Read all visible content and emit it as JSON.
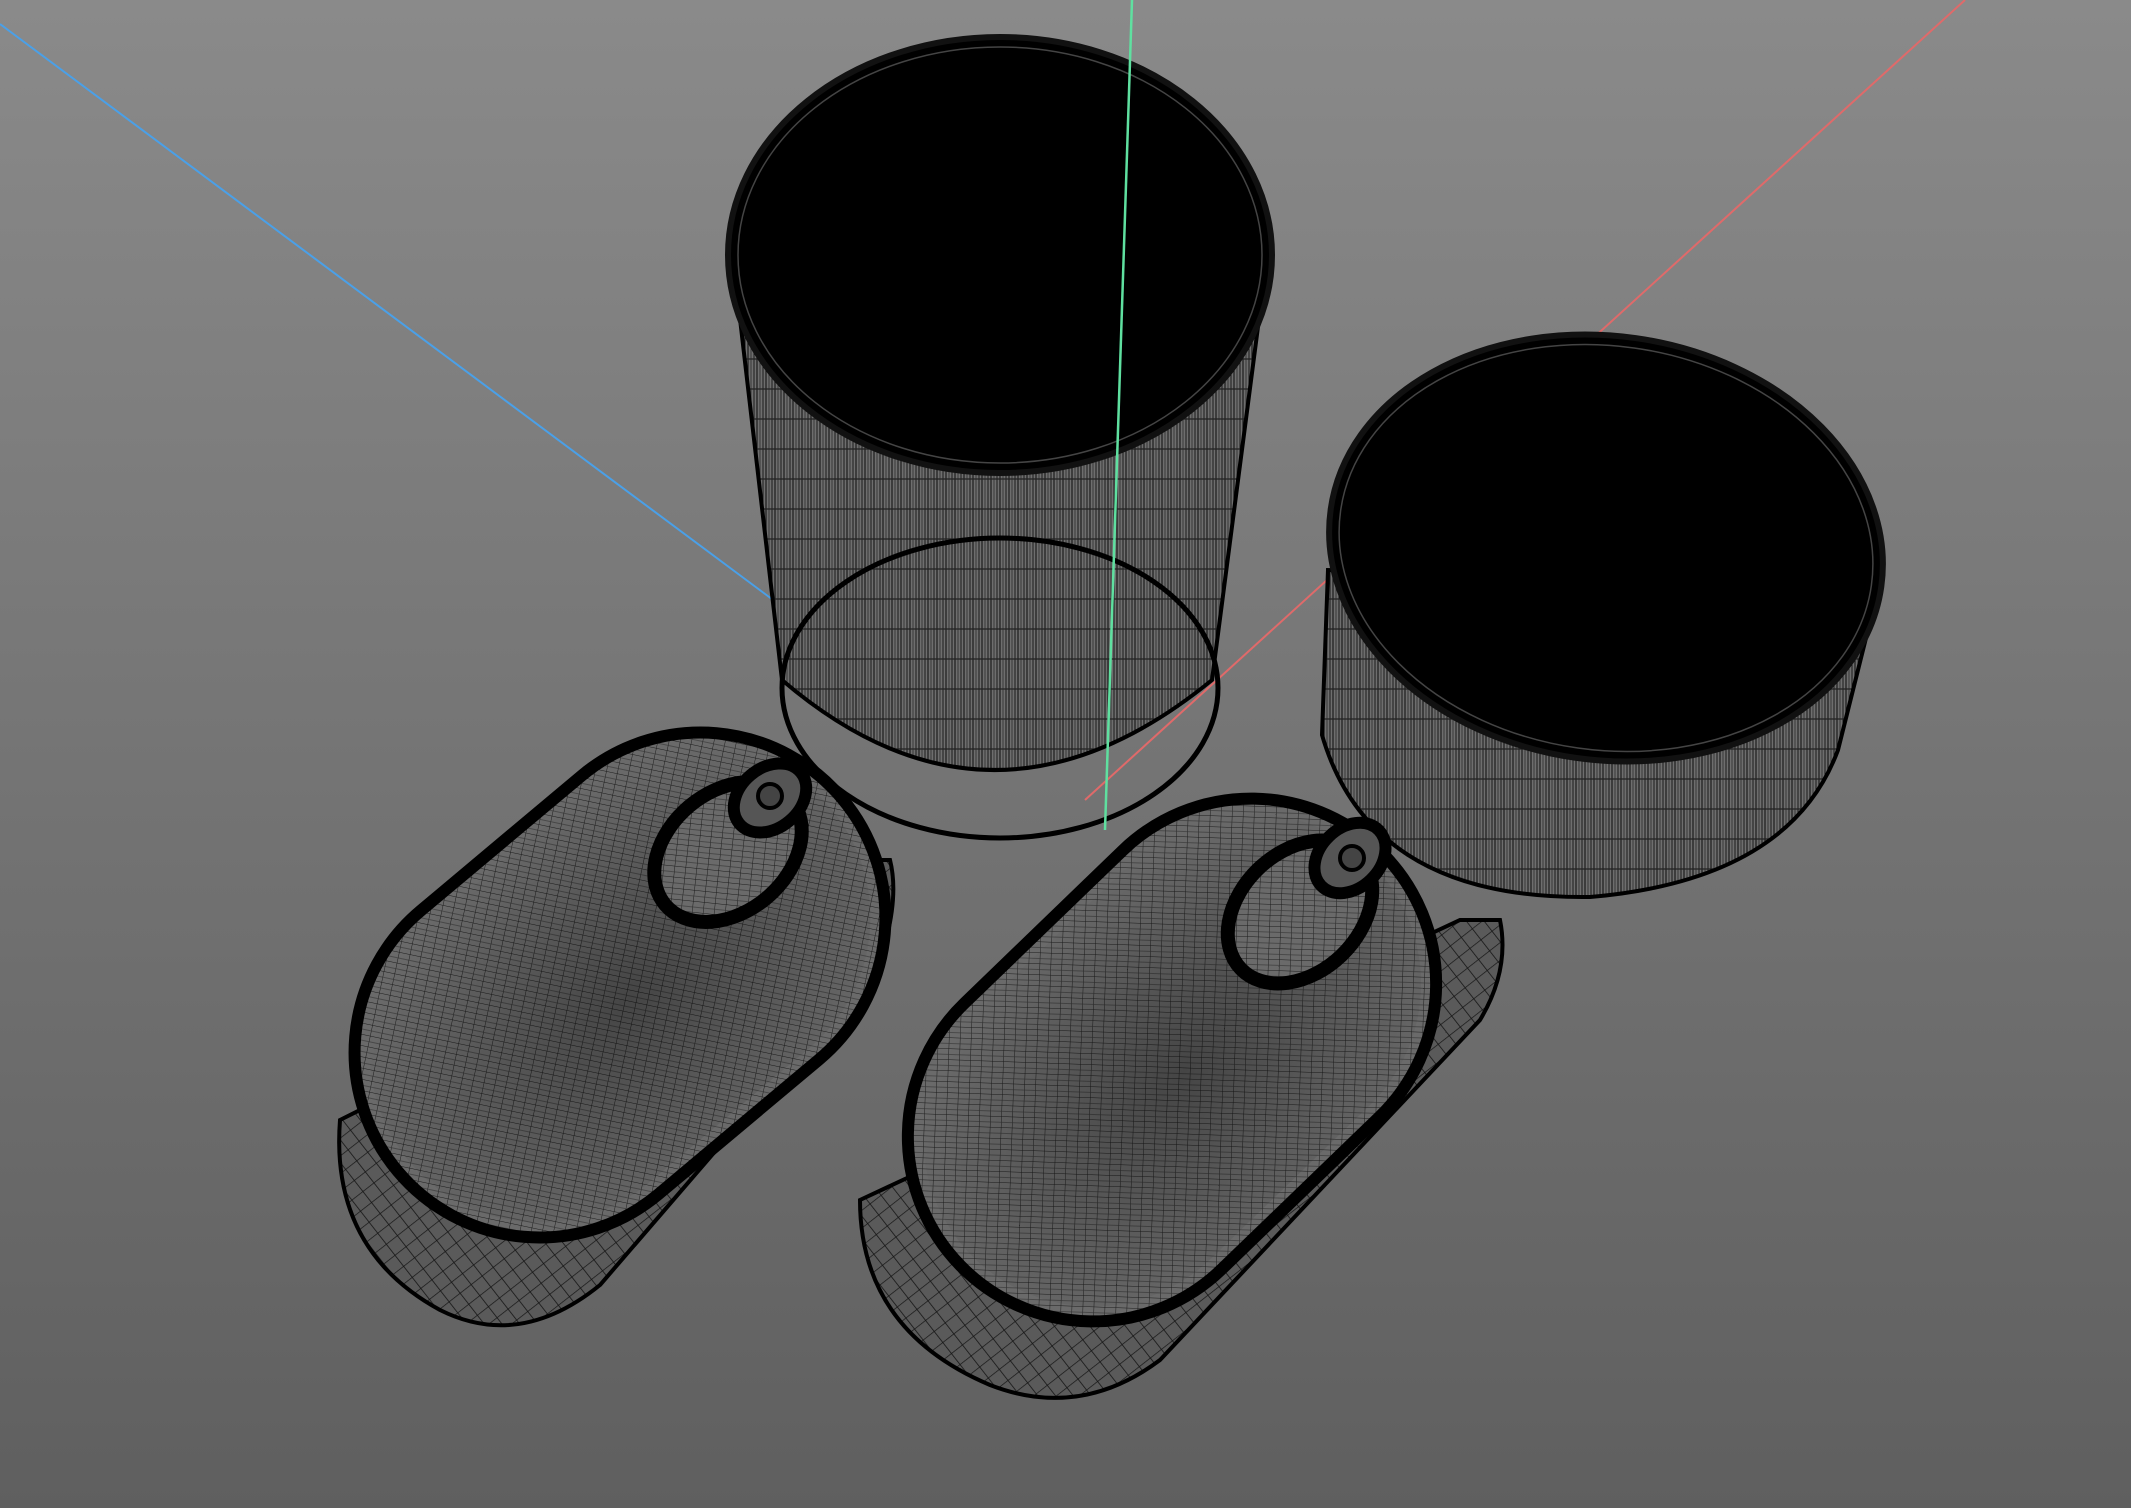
{
  "scene": {
    "background": {
      "top_color": "#8a8a8a",
      "bottom_color": "#5f5f5f"
    },
    "axes": {
      "x_color": "#e06a6a",
      "y_color": "#5fe0a0",
      "z_color": "#4aa0e8"
    },
    "objects": [
      {
        "name": "tall-round-can",
        "wire_color": "#000000"
      },
      {
        "name": "short-round-can",
        "wire_color": "#000000"
      },
      {
        "name": "oval-sardine-can-left",
        "wire_color": "#000000"
      },
      {
        "name": "oval-sardine-can-right",
        "wire_color": "#000000"
      }
    ]
  }
}
